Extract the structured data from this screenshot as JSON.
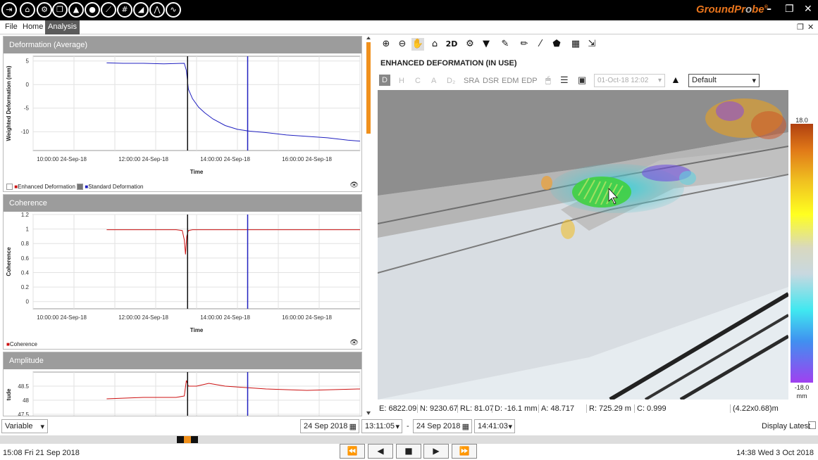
{
  "app": {
    "brand_main": "GroundPr",
    "brand_o": "o",
    "brand_end": "be",
    "brand_tm": "®"
  },
  "titlebar": {
    "icons": [
      "exit-icon",
      "home-icon",
      "settings-icon",
      "copy-icon",
      "terrain-icon",
      "circle-icon",
      "chart-icon",
      "grid-chart-icon",
      "slope-icon",
      "multi-chart-icon",
      "wave-icon"
    ],
    "window_controls": [
      "–",
      "❐",
      "✕"
    ]
  },
  "menu": {
    "items": [
      "File",
      "Home",
      "Analysis"
    ],
    "active": "Analysis",
    "restore": "❐",
    "close": "✕"
  },
  "panels": {
    "deformation": {
      "title": "Deformation (Average)",
      "ylabel": "Weighted Deformation (mm)",
      "xlabel": "Time",
      "legend_enh": "Enhanced Deformation",
      "legend_std": "Standard Deformation"
    },
    "coherence": {
      "title": "Coherence",
      "ylabel": "Coherence",
      "xlabel": "Time",
      "legend": "Coherence"
    },
    "amplitude": {
      "title": "Amplitude",
      "ylabel": "tude"
    }
  },
  "chart_data": [
    {
      "type": "line",
      "title": "Deformation (Average)",
      "ylabel": "Weighted Deformation (mm)",
      "xlabel": "Time",
      "yticks": [
        "5",
        "0",
        "-5",
        "-10"
      ],
      "xticks": [
        "10:00:00 24-Sep-18",
        "12:00:00 24-Sep-18",
        "14:00:00 24-Sep-18",
        "16:00:00 24-Sep-18"
      ],
      "ylim": [
        -14,
        6
      ],
      "series": [
        {
          "name": "Standard Deformation",
          "color": "#2020c0",
          "x": [
            11.1,
            11.5,
            12.0,
            12.5,
            13.0,
            13.05,
            13.1,
            13.2,
            13.35,
            13.5,
            13.7,
            14.0,
            14.3,
            14.6,
            15.0,
            15.5,
            16.0,
            16.5,
            17.0,
            17.3
          ],
          "y": [
            4.6,
            4.5,
            4.5,
            4.4,
            4.5,
            3.0,
            -1.0,
            -3.0,
            -4.8,
            -6.0,
            -7.3,
            -8.7,
            -9.5,
            -9.9,
            -10.2,
            -10.7,
            -11.0,
            -11.3,
            -11.8,
            -12.0
          ]
        }
      ],
      "markers": [
        {
          "x": 13.08,
          "color": "#111"
        },
        {
          "x": 14.55,
          "color": "#2020c0"
        }
      ]
    },
    {
      "type": "line",
      "title": "Coherence",
      "ylabel": "Coherence",
      "xlabel": "Time",
      "yticks": [
        "1.2",
        "1",
        "0.8",
        "0.6",
        "0.4",
        "0.2",
        "0"
      ],
      "xticks": [
        "10:00:00 24-Sep-18",
        "12:00:00 24-Sep-18",
        "14:00:00 24-Sep-18",
        "16:00:00 24-Sep-18"
      ],
      "ylim": [
        -0.1,
        1.2
      ],
      "series": [
        {
          "name": "Coherence",
          "color": "#cc1010",
          "x": [
            11.1,
            12.0,
            12.8,
            12.95,
            13.0,
            13.03,
            13.06,
            13.1,
            13.2,
            14.0,
            15.0,
            16.0,
            17.3
          ],
          "y": [
            0.99,
            0.99,
            0.99,
            0.98,
            0.85,
            0.65,
            0.9,
            0.98,
            0.99,
            0.99,
            0.99,
            0.99,
            0.99
          ]
        }
      ],
      "markers": [
        {
          "x": 13.08,
          "color": "#111"
        },
        {
          "x": 14.55,
          "color": "#2020c0"
        }
      ]
    },
    {
      "type": "line",
      "title": "Amplitude",
      "ylabel": "tude",
      "yticks": [
        "48.5",
        "48",
        "47.5"
      ],
      "ylim": [
        47.4,
        49.0
      ],
      "series": [
        {
          "name": "Amplitude",
          "color": "#cc1010",
          "x": [
            11.1,
            12.0,
            12.8,
            13.0,
            13.05,
            13.1,
            13.3,
            13.6,
            14.0,
            14.5,
            15.0,
            16.0,
            17.3
          ],
          "y": [
            48.05,
            48.1,
            48.1,
            48.15,
            48.7,
            48.5,
            48.5,
            48.6,
            48.5,
            48.45,
            48.4,
            48.35,
            48.4
          ]
        }
      ],
      "markers": [
        {
          "x": 13.08,
          "color": "#111"
        },
        {
          "x": 14.55,
          "color": "#2020c0"
        }
      ]
    }
  ],
  "rightpane": {
    "title": "ENHANCED DEFORMATION  (IN USE)",
    "toolbar1": [
      "zoom-in-icon",
      "zoom-out-icon",
      "pan-hand-icon",
      "home-view-icon",
      "2D",
      "settings-gear-icon",
      "filter-icon",
      "edit-icon",
      "pencil-icon",
      "brush-icon",
      "polygon-icon",
      "calculator-icon",
      "export-icon"
    ],
    "modes": [
      "D",
      "H",
      "C",
      "A",
      "D₂",
      "SRA",
      "DSR",
      "EDM",
      "EDP"
    ],
    "date_select": "01-Oct-18 12:02",
    "palette": "Default",
    "colorbar": {
      "max": "18.0",
      "min": "-18.0",
      "unit": "mm"
    },
    "status": {
      "E": "E: 6822.09",
      "N": "N: 9230.67",
      "RL": "RL: 81.07",
      "D": "D: -16.1 mm",
      "A": "A: 48.717",
      "R": "R: 725.29 m",
      "C": "C: 0.999",
      "size": "(4.22x0.68)m"
    }
  },
  "bottom": {
    "mode": "Variable",
    "start_date": "24 Sep 2018",
    "start_time": "13:11:05",
    "sep": "-",
    "end_date": "24 Sep 2018",
    "end_time": "14:41:03",
    "display_latest": "Display Latest"
  },
  "footer": {
    "left": "15:08 Fri 21 Sep 2018",
    "right": "14:38 Wed 3 Oct 2018",
    "buttons": [
      "⏪",
      "◀",
      "■",
      "▶",
      "⏩"
    ]
  }
}
